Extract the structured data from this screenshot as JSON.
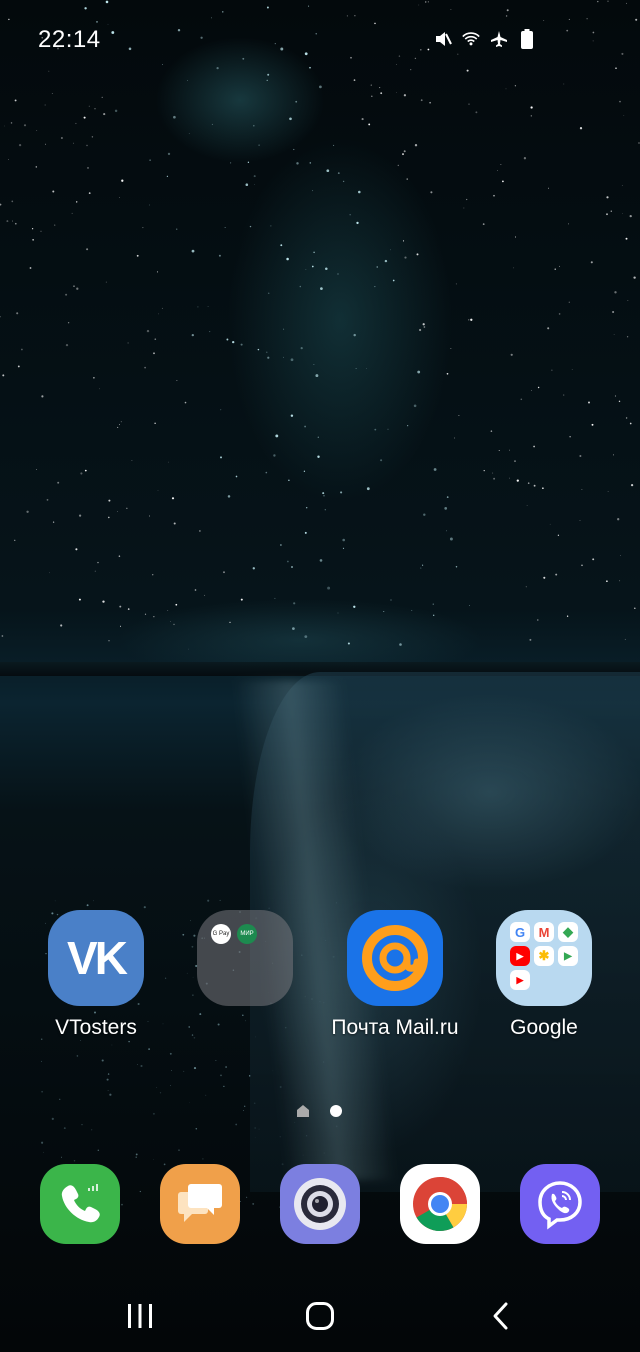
{
  "status_bar": {
    "time": "22:14",
    "icons": [
      "mute-icon",
      "wifi-icon",
      "airplane-mode-icon",
      "battery-icon"
    ]
  },
  "home_apps": [
    {
      "label": "VTosters",
      "icon": "vk-icon",
      "type": "app"
    },
    {
      "label": "",
      "icon": "folder-icon",
      "type": "folder",
      "contents": [
        "G Pay",
        "МИР Pay"
      ]
    },
    {
      "label": "Почта Mail.ru",
      "icon": "mail-ru-icon",
      "type": "app"
    },
    {
      "label": "Google",
      "icon": "google-folder-icon",
      "type": "folder",
      "contents": [
        "Google",
        "Gmail",
        "Maps",
        "YouTube",
        "Photos",
        "Play Store",
        "YouTube Music"
      ]
    }
  ],
  "folder_minis": {
    "gpay": "G Pay",
    "mir": "МИР"
  },
  "vk_logo": "VK",
  "pager": {
    "pages": 2,
    "current": 2
  },
  "dock": [
    "phone-icon",
    "messages-icon",
    "camera-icon",
    "chrome-icon",
    "viber-icon"
  ],
  "nav": [
    "recents-button",
    "home-button",
    "back-button"
  ],
  "colors": {
    "phone": "#3bb54a",
    "messages": "#f0a04a",
    "camera": "#7c7fe0",
    "viber": "#7360f2",
    "vk": "#4a80c8",
    "mail": "#1a73e8"
  }
}
